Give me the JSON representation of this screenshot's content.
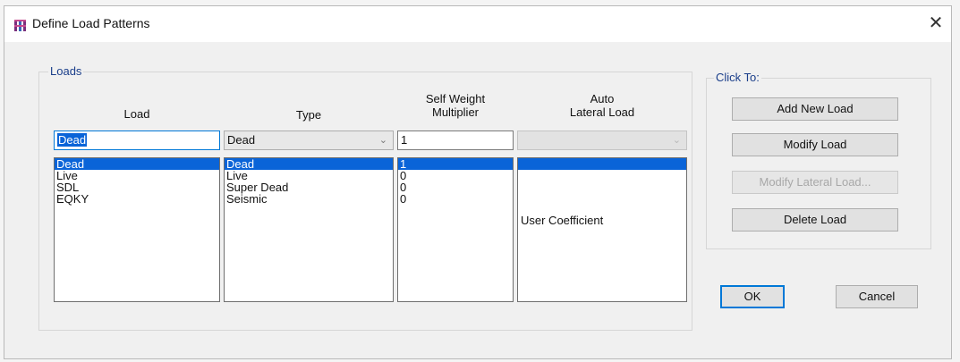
{
  "window": {
    "title": "Define Load Patterns",
    "close_glyph": "✕"
  },
  "loads_group": {
    "label": "Loads",
    "headers": {
      "load": "Load",
      "type": "Type",
      "self_weight_line1": "Self Weight",
      "self_weight_line2": "Multiplier",
      "auto_line1": "Auto",
      "auto_line2": "Lateral Load"
    },
    "inputs": {
      "load_name": "Dead",
      "type": "Dead",
      "multiplier": "1",
      "auto_lateral": ""
    },
    "rows": [
      {
        "load": "Dead",
        "type": "Dead",
        "multiplier": "1",
        "auto_lateral": ""
      },
      {
        "load": "Live",
        "type": "Live",
        "multiplier": "0",
        "auto_lateral": ""
      },
      {
        "load": "SDL",
        "type": "Super Dead",
        "multiplier": "0",
        "auto_lateral": ""
      },
      {
        "load": "EQKY",
        "type": "Seismic",
        "multiplier": "0",
        "auto_lateral": "User Coefficient"
      }
    ],
    "selected_row": 0
  },
  "click_to": {
    "label": "Click To:",
    "add_new_load": "Add New Load",
    "modify_load": "Modify Load",
    "modify_lateral_load": "Modify Lateral Load...",
    "delete_load": "Delete Load"
  },
  "footer": {
    "ok": "OK",
    "cancel": "Cancel"
  },
  "icons": {
    "app": "etabs-app-icon",
    "dropdown": "chevron-down-icon",
    "close": "close-icon"
  },
  "colors": {
    "selection": "#0a64d8",
    "focus_border": "#0078d7",
    "group_label": "#1a3e8a"
  }
}
